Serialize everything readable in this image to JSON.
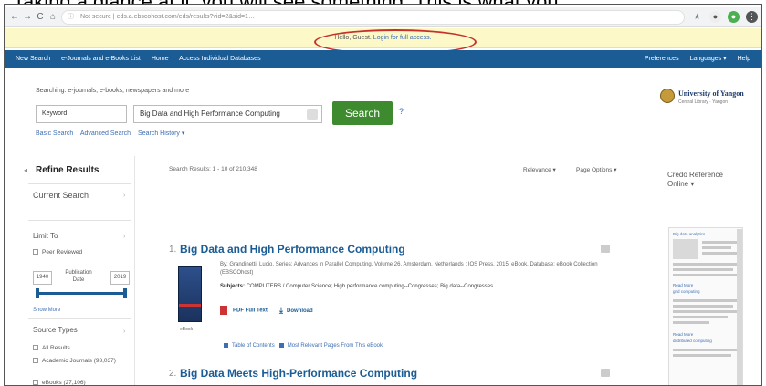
{
  "caption": {
    "text": "Taking a glance at it, you will see something. This is what you"
  },
  "browser": {
    "nav_back": "←",
    "nav_forward": "→",
    "nav_reload": "C",
    "nav_home": "⌂",
    "url_secure": "Not secure",
    "url": "eds.a.ebscohost.com/eds/results?vid=2&sid=1…"
  },
  "guest_bar": {
    "hello": "Hello, Guest.",
    "login": "Login for full access."
  },
  "top_nav": {
    "left": [
      "New Search",
      "e-Journals and e-Books List",
      "Home",
      "Access Individual Databases"
    ],
    "right": [
      "Preferences",
      "Languages ▾",
      "Help"
    ]
  },
  "search": {
    "searching_label": "Searching: e-journals, e-books, newspapers and more",
    "field": "Keyword",
    "query": "Big Data and High Performance Computing",
    "button": "Search",
    "help": "?",
    "links": [
      "Basic Search",
      "Advanced Search",
      "Search History ▾"
    ]
  },
  "university": {
    "name": "University of Yangon",
    "sub": "Central Library · Yangon"
  },
  "refine": {
    "title": "Refine Results",
    "current_search": "Current Search",
    "limit_to": "Limit To",
    "peer_reviewed": "Peer Reviewed",
    "year_from": "1940",
    "year_to": "2019",
    "pub_date": "Publication Date",
    "show_more": "Show More",
    "source_types": "Source Types",
    "sources": [
      "All Results",
      "Academic Journals (93,037)",
      "eBooks (27,106)"
    ]
  },
  "results": {
    "count": "Search Results: 1 - 10 of 210,348",
    "relevance": "Relevance ▾",
    "page_options": "Page Options ▾",
    "items": [
      {
        "num": "1.",
        "title": "Big Data and High Performance Computing",
        "meta": "By: Grandinetti, Lucio. Series: Advances in Parallel Computing, Volume 26. Amsterdam, Netherlands : IOS Press. 2015. eBook. Database: eBook Collection (EBSCOhost)",
        "subjects_label": "Subjects:",
        "subjects": "COMPUTERS / Computer Science; High performance computing--Congresses; Big data--Congresses",
        "ebook_label": "eBook",
        "pdf_label": "PDF Full Text",
        "download_label": "Download",
        "toc_label": "Table of Contents",
        "relevant_label": "Most Relevant Pages From This eBook"
      },
      {
        "num": "2.",
        "title": "Big Data Meets High-Performance Computing"
      }
    ]
  },
  "credo": {
    "title": "Credo Reference Online ▾",
    "links": [
      "Big data analytics",
      "Read More",
      "grid computing",
      "Read More",
      "distributed computing"
    ]
  }
}
